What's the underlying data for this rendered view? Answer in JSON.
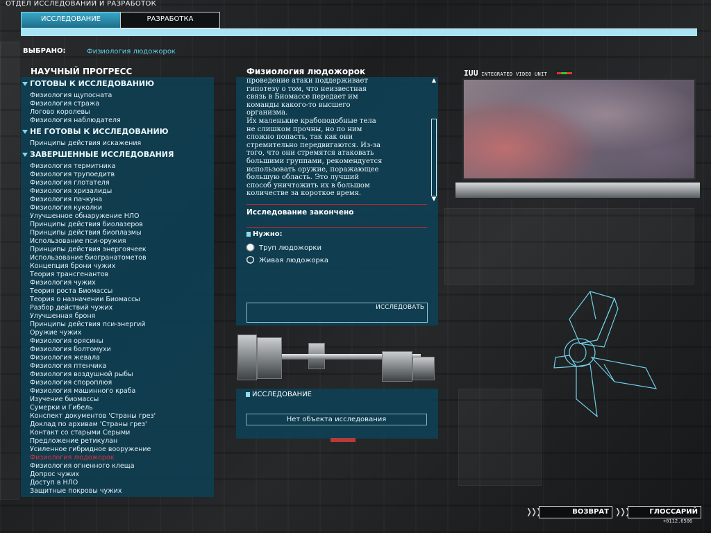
{
  "header": {
    "title": "ОТДЕЛ ИССЛЕДОВАНИЙ И РАЗРАБОТОК",
    "tabs": [
      {
        "label": "ИССЛЕДОВАНИЕ",
        "active": true
      },
      {
        "label": "РАЗРАБОТКА",
        "active": false
      }
    ]
  },
  "selection": {
    "label": "ВЫБРАНО:",
    "value": "Физиология людожорок"
  },
  "progress": {
    "title": "НАУЧНЫЙ ПРОГРЕСС",
    "sections": [
      {
        "title": "ГОТОВЫ К ИССЛЕДОВАНИЮ",
        "items": [
          "Физиология щупосната",
          "Физиология стража",
          "Логово королевы",
          "Физиология наблюдателя"
        ]
      },
      {
        "title": "НЕ ГОТОВЫ К ИССЛЕДОВАНИЮ",
        "items": [
          "Принципы действия искажения"
        ]
      },
      {
        "title": "ЗАВЕРШЕННЫЕ ИССЛЕДОВАНИЯ",
        "items": [
          "Физиология термитника",
          "Физиология трупоедитв",
          "Физиология глотателя",
          "Физиология хризалиды",
          "Физиология пачкуна",
          "Физиология куколки",
          "Улучшенное обнаружение НЛО",
          "Принципы действия биолазеров",
          "Принципы действия биоплазмы",
          "Использование пси-оружия",
          "Принципы действия энергоячеек",
          "Использование биогранатометов",
          "Концепция брони чужих",
          "Теория трансгенантов",
          "Физиология чужих",
          "Теория роста Биомассы",
          "Теория о назначении Биомассы",
          "Разбор действий чужих",
          "Улучшенная броня",
          "Принципы действия пси-энергий",
          "Оружие чужих",
          "Физиология орясины",
          "Физиология болтомухи",
          "Физиология жевала",
          "Физиология птенчика",
          "Физиология воздушной рыбы",
          "Физиология спороплюя",
          "Физиология машинного краба",
          "Изучение биомассы",
          "Сумерки и Гибель",
          "Конспект документов 'Страны грез'",
          "Доклад по архивам 'Страны грез'",
          "Контакт со старыми Серыми",
          "Предложение ретикулан",
          "Усиленное гибридное вооружение",
          "Физиология людожорок",
          "Физиология огненного клеща",
          "Допрос чужих",
          "Доступ в НЛО",
          "Защитные покровы чужих"
        ],
        "selected_index": 35
      }
    ]
  },
  "detail": {
    "title": "Физиология людожорок",
    "description_lines": [
      "проведение атаки поддерживает",
      "гипотезу о том, что неизвестная",
      "связь в Биомассе передает им",
      "команды какого-то высшего",
      "организма.",
      "Их маленькие крабоподобные тела",
      "не слишком прочны, но по ним",
      "сложно попасть, так как они",
      "стремительно передвигаются. Из-за",
      "того, что они стремятся атаковать",
      "большими группами, рекомендуется",
      "использовать оружие, поражающее",
      "большую область. Это лучший",
      "способ уничтожить их в большом",
      "количестве за короткое время."
    ],
    "status": "Исследование закончено",
    "needs_label": "Нужно:",
    "requirements": [
      "Труп людожорки",
      "Живая людожорка"
    ],
    "research_button": "ИССЛЕДОВАТЬ"
  },
  "lab": {
    "header": "ИССЛЕДОВАНИЕ",
    "no_object": "Нет объекта исследования"
  },
  "video": {
    "label_big": "IUU",
    "label_small": "INTEGRATED VIDEO UNIT"
  },
  "footer": {
    "back_button": "ВОЗВРАТ",
    "glossary_button": "ГЛОССАРИЙ",
    "coord": "+0112.6506"
  },
  "colors": {
    "panel": "#0e4054",
    "accent": "#a9e4f4",
    "selected": "#d9333a",
    "value_text": "#5fd0ea"
  }
}
